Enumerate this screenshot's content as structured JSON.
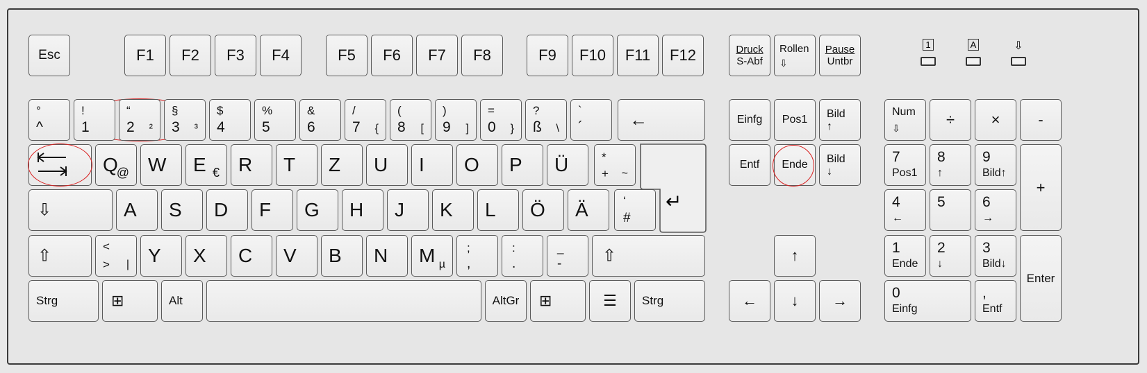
{
  "function_row": {
    "esc": "Esc",
    "f": [
      "F1",
      "F2",
      "F3",
      "F4",
      "F5",
      "F6",
      "F7",
      "F8",
      "F9",
      "F10",
      "F11",
      "F12"
    ],
    "druck_top": "Druck",
    "druck_bottom": "S-Abf",
    "rollen_top": "Rollen",
    "rollen_bottom": "⇩",
    "pause_top": "Pause",
    "pause_bottom": "Untbr"
  },
  "leds": {
    "num": "1",
    "caps": "A",
    "scroll": "⇩"
  },
  "number_row": [
    {
      "top": "°",
      "bottom": "^",
      "alt": ""
    },
    {
      "top": "!",
      "bottom": "1",
      "alt": ""
    },
    {
      "top": "“",
      "bottom": "2",
      "alt": "²"
    },
    {
      "top": "§",
      "bottom": "3",
      "alt": "³"
    },
    {
      "top": "$",
      "bottom": "4",
      "alt": ""
    },
    {
      "top": "%",
      "bottom": "5",
      "alt": ""
    },
    {
      "top": "&",
      "bottom": "6",
      "alt": ""
    },
    {
      "top": "/",
      "bottom": "7",
      "alt": "{"
    },
    {
      "top": "(",
      "bottom": "8",
      "alt": "["
    },
    {
      "top": ")",
      "bottom": "9",
      "alt": "]"
    },
    {
      "top": "=",
      "bottom": "0",
      "alt": "}"
    },
    {
      "top": "?",
      "bottom": "ß",
      "alt": "\\"
    },
    {
      "top": "`",
      "bottom": "´",
      "alt": ""
    }
  ],
  "backspace": "←",
  "tab": "⭾",
  "qwertz": [
    {
      "main": "Q",
      "alt": "@"
    },
    {
      "main": "W",
      "alt": ""
    },
    {
      "main": "E",
      "alt": "€"
    },
    {
      "main": "R",
      "alt": ""
    },
    {
      "main": "T",
      "alt": ""
    },
    {
      "main": "Z",
      "alt": ""
    },
    {
      "main": "U",
      "alt": ""
    },
    {
      "main": "I",
      "alt": ""
    },
    {
      "main": "O",
      "alt": ""
    },
    {
      "main": "P",
      "alt": ""
    },
    {
      "main": "Ü",
      "alt": ""
    }
  ],
  "plus_key": {
    "top": "*",
    "bottom": "+",
    "alt": "~"
  },
  "enter_arrow": "↵",
  "caps": "⇩",
  "asdf": [
    "A",
    "S",
    "D",
    "F",
    "G",
    "H",
    "J",
    "K",
    "L",
    "Ö",
    "Ä"
  ],
  "hash_key": {
    "top": "‘",
    "bottom": "#"
  },
  "shift": "⇧",
  "less_key": {
    "top": "<",
    "bottom": ">",
    "alt": "|"
  },
  "yxcv": [
    {
      "main": "Y",
      "alt": ""
    },
    {
      "main": "X",
      "alt": ""
    },
    {
      "main": "C",
      "alt": ""
    },
    {
      "main": "V",
      "alt": ""
    },
    {
      "main": "B",
      "alt": ""
    },
    {
      "main": "N",
      "alt": ""
    },
    {
      "main": "M",
      "alt": "µ"
    }
  ],
  "punct": [
    {
      "top": ";",
      "bottom": ","
    },
    {
      "top": ":",
      "bottom": "."
    },
    {
      "top": "_",
      "bottom": "-"
    }
  ],
  "bottom_row": {
    "strg_left": "Strg",
    "win_left": "⊞",
    "alt": "Alt",
    "altgr": "AltGr",
    "win_right": "⊞",
    "menu": "☰",
    "strg_right": "Strg"
  },
  "nav": {
    "einfg": "Einfg",
    "pos1": "Pos1",
    "bild_up_top": "Bild",
    "bild_up_bottom": "↑",
    "entf": "Entf",
    "ende": "Ende",
    "bild_down_top": "Bild",
    "bild_down_bottom": "↓"
  },
  "arrows": {
    "up": "↑",
    "left": "←",
    "down": "↓",
    "right": "→"
  },
  "numpad": {
    "num_top": "Num",
    "num_bottom": "⇩",
    "div": "÷",
    "mul": "×",
    "minus": "-",
    "plus": "+",
    "k7": {
      "top": "7",
      "bottom": "Pos1"
    },
    "k8": {
      "top": "8",
      "bottom": "↑"
    },
    "k9": {
      "top": "9",
      "bottom": "Bild↑"
    },
    "k4": {
      "top": "4",
      "bottom": "←"
    },
    "k5": {
      "top": "5",
      "bottom": ""
    },
    "k6": {
      "top": "6",
      "bottom": "→"
    },
    "k1": {
      "top": "1",
      "bottom": "Ende"
    },
    "k2": {
      "top": "2",
      "bottom": "↓"
    },
    "k3": {
      "top": "3",
      "bottom": "Bild↓"
    },
    "k0": {
      "top": "0",
      "bottom": "Einfg"
    },
    "kdot": {
      "top": ",",
      "bottom": "Entf"
    },
    "enter": "Enter"
  },
  "colors": {
    "highlight_ring": "#d81e1e",
    "key_border": "#5a5a5a",
    "board_border": "#3a3a3a"
  }
}
